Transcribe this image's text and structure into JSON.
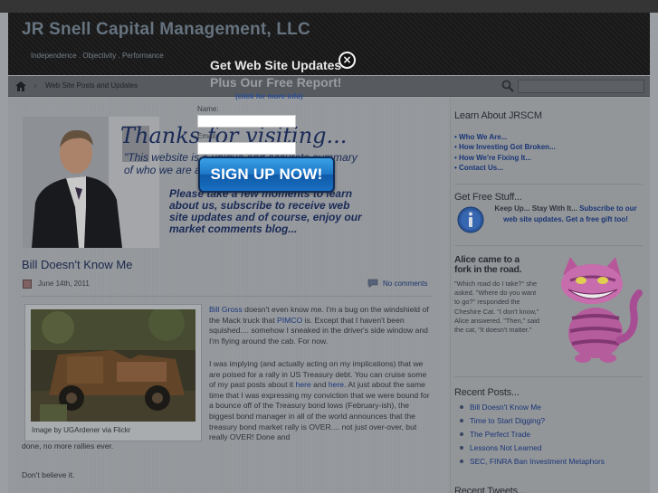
{
  "header": {
    "site_title": "JR Snell Capital Management, LLC",
    "tagline": "Independence . Objectivity . Performance"
  },
  "nav": {
    "home_icon": "home-icon",
    "link": "Web Site Posts and Updates",
    "search_icon": "search-icon",
    "search_placeholder": ""
  },
  "banner": {
    "thanks": "Thanks for visiting...",
    "quote": "\"This website is a unique and accurate summary of who we are and what we do.\"",
    "cta": "Please take a few moments to learn about us, subscribe to receive web site updates and of course, enjoy our market comments blog..."
  },
  "post": {
    "title": "Bill Doesn't Know Me",
    "date": "June 14th, 2011",
    "comments": "No comments",
    "image_caption": "Image by UGArdener via Flickr",
    "p1_link1": "Bill Gross",
    "p1_text1": " doesn't even know me. I'm a bug on the windshield of the Mack truck that ",
    "p1_link2": "PIMCO",
    "p1_text2": " is. Except that I haven't been squished.... somehow I sneaked in the driver's side window and I'm flying around the cab. For now.",
    "p2_text1": "I was implying (and actually acting on my implications) that we are poised for a rally in US Treasury debt. You can cruise some of my past posts about it ",
    "p2_link1": "here",
    "p2_text2": " and ",
    "p2_link2": "here",
    "p2_text3": ". At just about the same time that I was expressing my conviction that we were bound for a bounce off of the Treasury bond lows (February-ish), the biggest bond manager in all of the world announces that the treasury bond market rally is OVER.... not just over-over, but really OVER! Done and",
    "p2_cont": "done, no more rallies ever.",
    "p3": "Don't believe it."
  },
  "sidebar": {
    "learn_heading": "Learn About JRSCM",
    "learn_items": [
      "• Who We Are...",
      "• How Investing Got Broken...",
      "• How We're Fixing It...",
      "• Contact Us..."
    ],
    "free_heading": "Get Free Stuff...",
    "free_text1": "Keep Up... Stay With It... ",
    "free_text2": "Subscribe to our web site updates. Get a free gift too!",
    "info_icon": "info-icon",
    "alice_heading": "Alice came to a fork in the road.",
    "alice_quote": "\"Which road do I take?\" she asked. \"Where do you want to go?\" responded the Cheshire Cat. \"I don't know,\" Alice answered. \"Then,\" said the cat, \"it doesn't matter.\"",
    "recent_heading": "Recent Posts...",
    "recent_items": [
      "Bill Doesn't Know Me",
      "Time to Start Digging?",
      "The Perfect Trade",
      "Lessons Not Learned",
      "SEC, FINRA Ban Investment Metaphors"
    ],
    "tweets_heading": "Recent Tweets..."
  },
  "modal": {
    "title": "Get Web Site Updates",
    "subtitle": "Plus Our Free Report!",
    "more_link": "(click for more info)",
    "close": "×",
    "name_label": "Name:",
    "email_label": "Email:",
    "name_value": "",
    "email_value": "",
    "signup_label": "SIGN UP NOW!"
  }
}
